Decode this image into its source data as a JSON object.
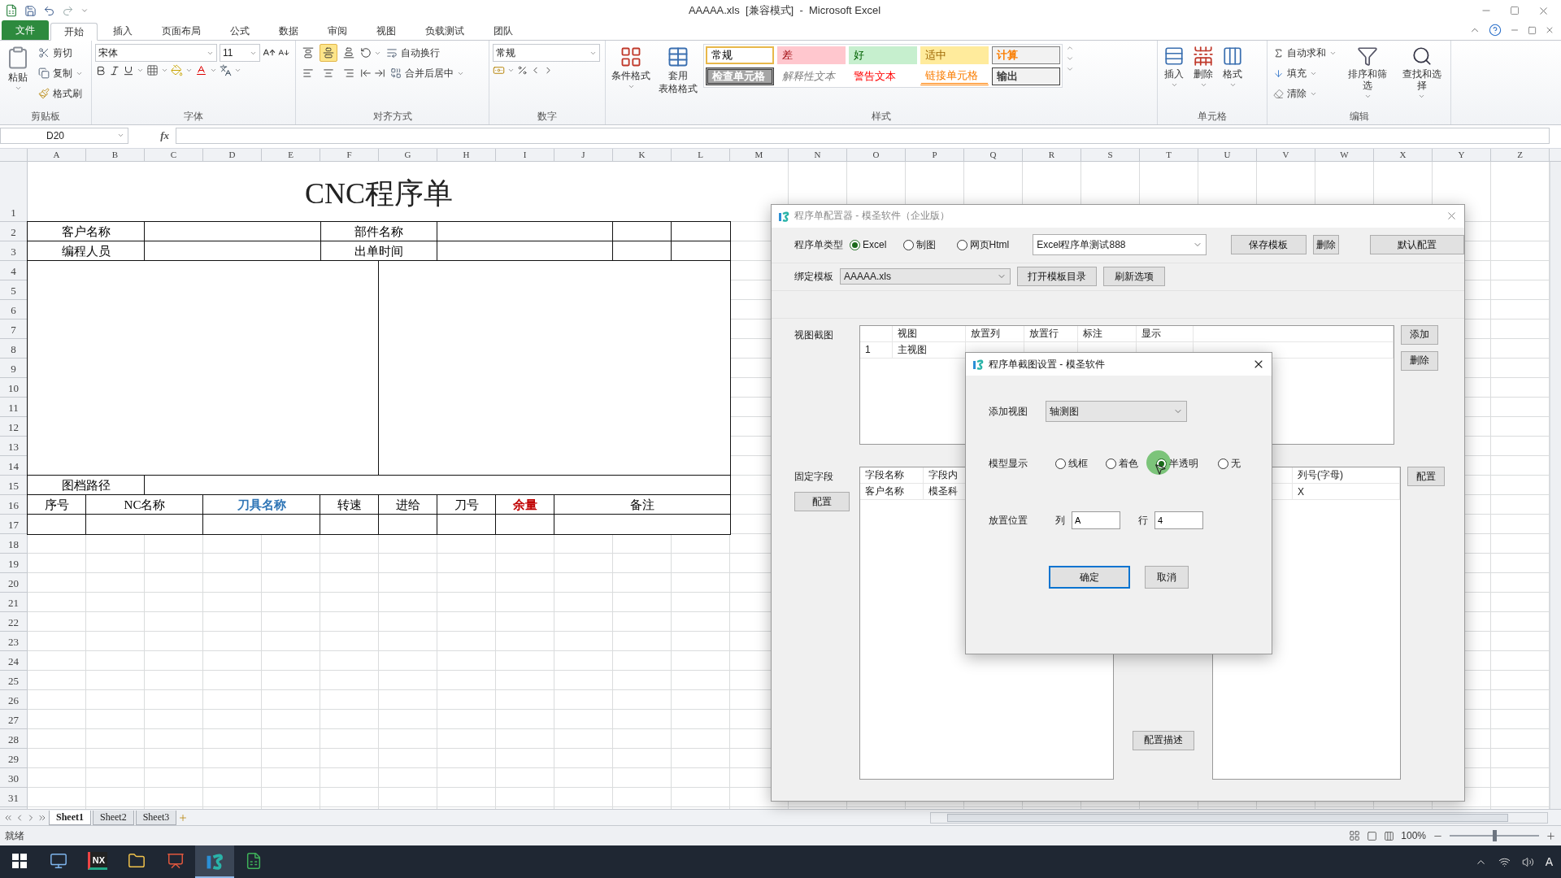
{
  "titlebar": {
    "title": "AAAAA.xls  [兼容模式]  -  Microsoft Excel"
  },
  "ribbon_tabs": [
    {
      "label": "文件",
      "kind": "file",
      "selected": false
    },
    {
      "label": "开始",
      "kind": "tab",
      "selected": true
    },
    {
      "label": "插入",
      "kind": "tab",
      "selected": false
    },
    {
      "label": "页面布局",
      "kind": "tab",
      "selected": false
    },
    {
      "label": "公式",
      "kind": "tab",
      "selected": false
    },
    {
      "label": "数据",
      "kind": "tab",
      "selected": false
    },
    {
      "label": "审阅",
      "kind": "tab",
      "selected": false
    },
    {
      "label": "视图",
      "kind": "tab",
      "selected": false
    },
    {
      "label": "负载测试",
      "kind": "tab",
      "selected": false
    },
    {
      "label": "团队",
      "kind": "tab",
      "selected": false
    }
  ],
  "clipboard": {
    "paste": "粘贴",
    "cut": "剪切",
    "copy": "复制",
    "painter": "格式刷",
    "label": "剪贴板"
  },
  "font": {
    "name": "宋体",
    "size": "11",
    "label": "字体"
  },
  "alignment": {
    "wrap": "自动换行",
    "merge": "合并后居中",
    "label": "对齐方式"
  },
  "number": {
    "format": "常规",
    "label": "数字"
  },
  "styles": {
    "conditional": "条件格式",
    "table_lines": [
      "套用",
      "表格格式"
    ],
    "label": "样式",
    "cells": [
      {
        "text": "常规",
        "kind": "normal"
      },
      {
        "text": "差",
        "kind": "bad"
      },
      {
        "text": "好",
        "kind": "good"
      },
      {
        "text": "适中",
        "kind": "neutral"
      },
      {
        "text": "计算",
        "kind": "calc"
      },
      {
        "text": "检查单元格",
        "kind": "check"
      },
      {
        "text": "解释性文本",
        "kind": "explain"
      },
      {
        "text": "警告文本",
        "kind": "warn"
      },
      {
        "text": "链接单元格",
        "kind": "link"
      },
      {
        "text": "输出",
        "kind": "output"
      }
    ]
  },
  "cells_group": {
    "insert": "插入",
    "delete": "删除",
    "format": "格式",
    "label": "单元格"
  },
  "editing": {
    "autosum": "自动求和",
    "fill": "填充",
    "clear": "清除",
    "sort": "排序和筛选",
    "find": "查找和选择",
    "label": "编辑"
  },
  "formula_bar": {
    "name_box": "D20",
    "fx": "fx"
  },
  "sheet": {
    "columns": [
      "A",
      "B",
      "C",
      "D",
      "E",
      "F",
      "G",
      "H",
      "I",
      "J",
      "K",
      "L",
      "M",
      "N",
      "O",
      "P",
      "Q",
      "R",
      "S",
      "T",
      "U",
      "V",
      "W",
      "X",
      "Y",
      "Z"
    ],
    "rows": [
      "1",
      "2",
      "3",
      "4",
      "5",
      "6",
      "7",
      "8",
      "9",
      "10",
      "11",
      "12",
      "13",
      "14",
      "15",
      "16",
      "17",
      "18",
      "19",
      "20",
      "21",
      "22",
      "23",
      "24",
      "25",
      "26",
      "27",
      "28",
      "29",
      "30",
      "31"
    ],
    "title": "CNC程序单",
    "info_rows": [
      [
        "客户名称",
        "部件名称"
      ],
      [
        "编程人员",
        "出单时间"
      ]
    ],
    "path_label": "图档路径",
    "table_headers": [
      {
        "text": "序号",
        "bold": false
      },
      {
        "text": "NC名称",
        "bold": false
      },
      {
        "text": "刀具名称",
        "color": "#2e75b6",
        "bold": true
      },
      {
        "text": "转速",
        "bold": false
      },
      {
        "text": "进给",
        "bold": false
      },
      {
        "text": "刀号",
        "bold": false
      },
      {
        "text": "余量",
        "color": "#c00000",
        "bold": true
      },
      {
        "text": "备注",
        "bold": false
      }
    ]
  },
  "sheet_tabs": [
    {
      "label": "Sheet1",
      "selected": true
    },
    {
      "label": "Sheet2",
      "selected": false
    },
    {
      "label": "Sheet3",
      "selected": false
    }
  ],
  "status_bar": {
    "status": "就绪",
    "zoom": {
      "reading": "100%",
      "level": 0.5
    }
  },
  "taskbar": {
    "apps": [
      {
        "kind": "computer",
        "active": false
      },
      {
        "kind": "nx",
        "label": "NX",
        "active": false
      },
      {
        "kind": "folder",
        "active": false
      },
      {
        "kind": "slides",
        "active": false
      },
      {
        "kind": "moshen",
        "active": true
      },
      {
        "kind": "excel",
        "active": false
      }
    ],
    "ime": "A"
  },
  "config_dialog": {
    "title": "程序单配置器 - 模圣软件（企业版）",
    "type_label": "程序单类型",
    "types": [
      {
        "label": "Excel",
        "selected": true
      },
      {
        "label": "制图",
        "selected": false
      },
      {
        "label": "网页Html",
        "selected": false
      }
    ],
    "template_name": "Excel程序单测试888",
    "top_buttons": [
      "保存模板",
      "删除",
      "默认配置"
    ],
    "bind_label": "绑定模板",
    "bind_value": "AAAAA.xls",
    "bind_buttons": [
      "打开模板目录",
      "刷新选项"
    ],
    "views": {
      "label": "视图截图",
      "columns": [
        "",
        "视图",
        "放置列",
        "放置行",
        "标注",
        "显示"
      ],
      "rows": [
        [
          "1",
          "主视图"
        ]
      ],
      "buttons": [
        "添加",
        "删除"
      ]
    },
    "fields": {
      "label": "固定字段",
      "config_button": "配置",
      "columns": [
        "字段名称",
        "字段内"
      ],
      "rows": [
        [
          "客户名称",
          "模圣科"
        ]
      ],
      "right_columns": [
        "",
        "列号(字母)"
      ],
      "right_rows": [
        [
          "",
          "X"
        ]
      ],
      "right_button": "配置",
      "describe_button": "配置描述"
    }
  },
  "shot_dialog": {
    "title": "程序单截图设置 - 模圣软件",
    "add_label": "添加视图",
    "add_value": "轴测图",
    "display_label": "模型显示",
    "display_options": [
      {
        "label": "线框",
        "selected": false
      },
      {
        "label": "着色",
        "selected": false
      },
      {
        "label": "半透明",
        "selected": true
      },
      {
        "label": "无",
        "selected": false
      }
    ],
    "pos_label": "放置位置",
    "col_label": "列",
    "col_value": "A",
    "row_label": "行",
    "row_value": "4",
    "ok": "确定",
    "cancel": "取消"
  }
}
